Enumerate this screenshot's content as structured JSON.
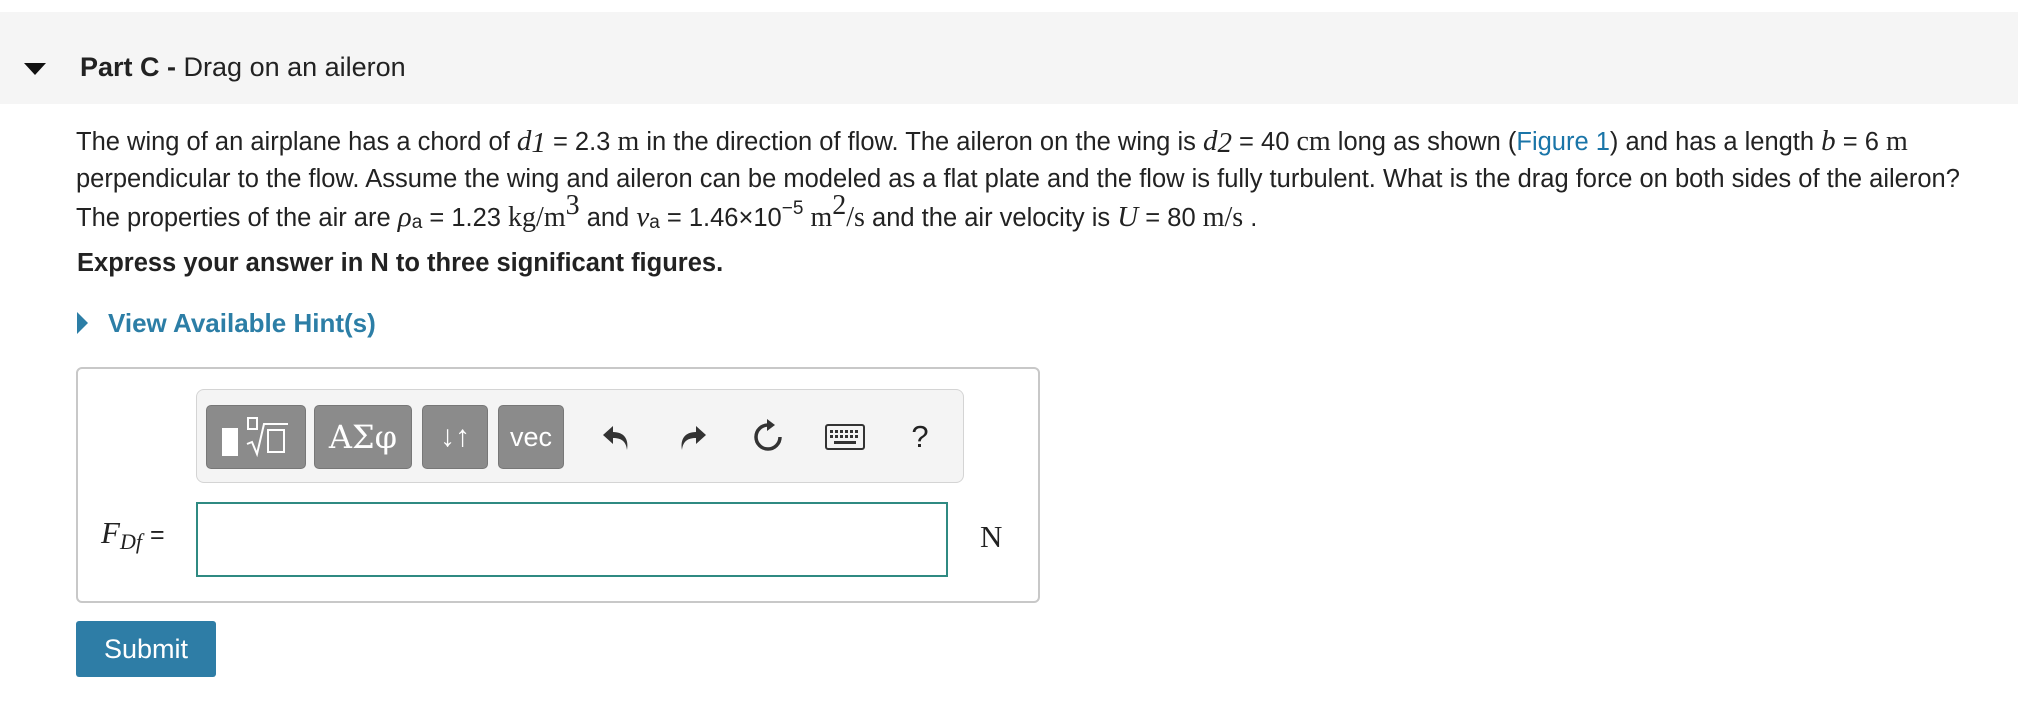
{
  "part": {
    "label": "Part C -",
    "title": "Drag on an aileron"
  },
  "problem": {
    "line1": {
      "t1": "The wing of an airplane has a chord of ",
      "var_d1": "d",
      "sub_d1": "1",
      "t2": " = 2.3 ",
      "unit_m1": "m",
      "t3": " in the direction of flow. The aileron on the wing is ",
      "var_d2": "d",
      "sub_d2": "2",
      "t4": " = 40 ",
      "unit_cm": "cm",
      "t5": " long as shown (",
      "figure_link": "Figure 1",
      "t6": ") and has a length ",
      "var_b": "b",
      "t7": " = 6 ",
      "unit_m2": "m"
    },
    "line2": "perpendicular to the flow. Assume the wing and aileron can be modeled as a flat plate and the flow is fully turbulent. What is the drag force on both sides of the aileron?",
    "line3": {
      "t1": "The properties of the air are ",
      "var_rho": "ρ",
      "sub_rho": "a",
      "t2": " = 1.23 ",
      "unit_rho": "kg/m",
      "sup_rho": "3",
      "t3": " and ",
      "var_nu": "ν",
      "sub_nu": "a",
      "t4": " = 1.46×10",
      "sup_exp": "−5",
      "unit_nu": "m",
      "sup_nu": "2",
      "unit_nu2": "/s",
      "t5": " and the air velocity is ",
      "var_U": "U",
      "t6": " = 80 ",
      "unit_U": "m/s",
      "t7": " ."
    }
  },
  "instruction": "Express your answer in N to three significant figures.",
  "hints": {
    "label": "View Available Hint(s)"
  },
  "toolbar": {
    "greek_label": "ΑΣφ",
    "arrows_label": "↓↑",
    "vec_label": "vec",
    "help_label": "?"
  },
  "answer": {
    "var": "F",
    "var_sub": "Df",
    "equals": "=",
    "value": "",
    "unit": "N"
  },
  "submit_label": "Submit",
  "colors": {
    "accent": "#2e7da6",
    "link": "#1a75a8",
    "input_border": "#2f8a82",
    "toolbar_button": "#8b8b8b"
  },
  "icons": [
    "collapse-caret-icon",
    "expand-caret-icon",
    "templates-icon",
    "undo-icon",
    "redo-icon",
    "reset-icon",
    "keyboard-icon",
    "help-icon"
  ]
}
